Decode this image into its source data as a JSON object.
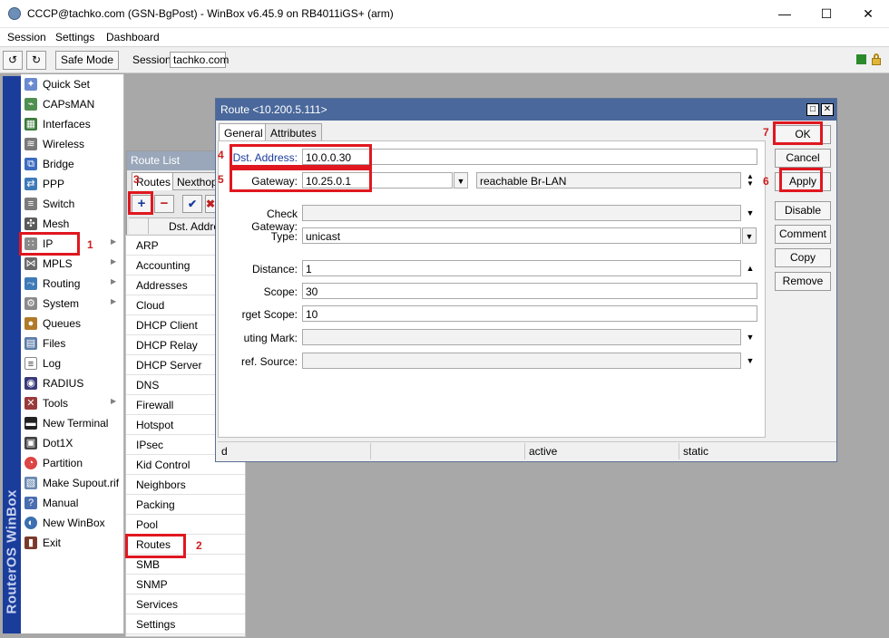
{
  "window": {
    "title": "CCCP@tachko.com (GSN-BgPost) - WinBox v6.45.9 on RB4011iGS+ (arm)",
    "minimize": "—",
    "maximize": "☐",
    "close": "✕"
  },
  "menubar": [
    "Session",
    "Settings",
    "Dashboard"
  ],
  "toolbar": {
    "undo": "↺",
    "redo": "↻",
    "safe_mode": "Safe Mode",
    "session_label": "Session:",
    "session_value": "tachko.com"
  },
  "brand": "RouterOS WinBox",
  "leftmenu": [
    {
      "label": "Quick Set",
      "icon": "quick-set-icon"
    },
    {
      "label": "CAPsMAN",
      "icon": "capsman-icon"
    },
    {
      "label": "Interfaces",
      "icon": "interfaces-icon"
    },
    {
      "label": "Wireless",
      "icon": "wireless-icon"
    },
    {
      "label": "Bridge",
      "icon": "bridge-icon"
    },
    {
      "label": "PPP",
      "icon": "ppp-icon"
    },
    {
      "label": "Switch",
      "icon": "switch-icon"
    },
    {
      "label": "Mesh",
      "icon": "mesh-icon"
    },
    {
      "label": "IP",
      "icon": "ip-icon",
      "submenu": true
    },
    {
      "label": "MPLS",
      "icon": "mpls-icon",
      "submenu": true
    },
    {
      "label": "Routing",
      "icon": "routing-icon",
      "submenu": true
    },
    {
      "label": "System",
      "icon": "system-icon",
      "submenu": true
    },
    {
      "label": "Queues",
      "icon": "queues-icon"
    },
    {
      "label": "Files",
      "icon": "files-icon"
    },
    {
      "label": "Log",
      "icon": "log-icon"
    },
    {
      "label": "RADIUS",
      "icon": "radius-icon"
    },
    {
      "label": "Tools",
      "icon": "tools-icon",
      "submenu": true
    },
    {
      "label": "New Terminal",
      "icon": "terminal-icon"
    },
    {
      "label": "Dot1X",
      "icon": "dot1x-icon"
    },
    {
      "label": "Partition",
      "icon": "partition-icon"
    },
    {
      "label": "Make Supout.rif",
      "icon": "supout-icon"
    },
    {
      "label": "Manual",
      "icon": "manual-icon"
    },
    {
      "label": "New WinBox",
      "icon": "winbox-icon"
    },
    {
      "label": "Exit",
      "icon": "exit-icon"
    }
  ],
  "ip_submenu": [
    "ARP",
    "Accounting",
    "Addresses",
    "Cloud",
    "DHCP Client",
    "DHCP Relay",
    "DHCP Server",
    "DNS",
    "Firewall",
    "Hotspot",
    "IPsec",
    "Kid Control",
    "Neighbors",
    "Packing",
    "Pool",
    "Routes",
    "SMB",
    "SNMP",
    "Services",
    "Settings"
  ],
  "route_list": {
    "title": "Route List",
    "tabs": [
      "Routes",
      "Nexthops"
    ],
    "column": "Dst. Address"
  },
  "dialog": {
    "title": "Route <10.200.5.111>",
    "tabs": [
      "General",
      "Attributes"
    ],
    "fields": {
      "dst_label": "Dst. Address:",
      "dst_value": "10.0.0.30",
      "gw_label": "Gateway:",
      "gw_value": "10.25.0.1",
      "gw_status": "reachable Br-LAN",
      "check_label": "Check Gateway:",
      "type_label": "Type:",
      "type_value": "unicast",
      "distance_label": "Distance:",
      "distance_value": "1",
      "scope_label": "Scope:",
      "scope_value": "30",
      "target_label": "rget Scope:",
      "target_value": "10",
      "mark_label": "uting Mark:",
      "pref_label": "ref. Source:"
    },
    "buttons": [
      "OK",
      "Cancel",
      "Apply",
      "Disable",
      "Comment",
      "Copy",
      "Remove"
    ],
    "status": [
      "d",
      "",
      "active",
      "static"
    ]
  },
  "annotations": [
    "1",
    "2",
    "3",
    "4",
    "5",
    "6",
    "7"
  ],
  "colors": {
    "highlight": "#e0171f",
    "sidebar": "#1a3d9c",
    "dialog_title": "#4a689b"
  }
}
